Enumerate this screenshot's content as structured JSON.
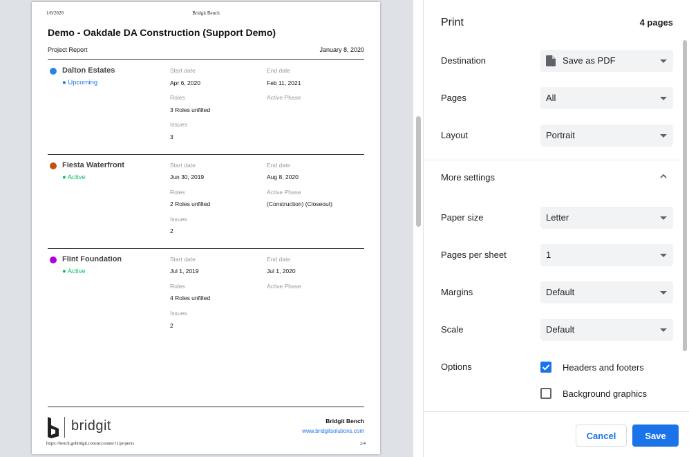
{
  "preview": {
    "header_date": "1/8/2020",
    "header_title": "Bridgit Bench",
    "doc_title": "Demo - Oakdale DA Construction (Support Demo)",
    "doc_subtitle": "Project Report",
    "doc_date": "January 8, 2020",
    "labels": {
      "start_date": "Start date",
      "end_date": "End date",
      "roles": "Roles",
      "active_phase": "Active Phase",
      "issues": "Issues"
    },
    "projects": [
      {
        "name": "Dalton Estates",
        "status": "● Upcoming",
        "status_color": "#1a73e8",
        "dot_color": "#2f80ed",
        "start": "Apr 6, 2020",
        "end": "Feb 11, 2021",
        "roles": "3 Roles unfilled",
        "phase": "",
        "issues": "3"
      },
      {
        "name": "Fiesta Waterfront",
        "status": "● Active",
        "status_color": "#0bbf6a",
        "dot_color": "#c4510f",
        "start": "Jun 30, 2019",
        "end": "Aug 8, 2020",
        "roles": "2 Roles unfilled",
        "phase": "(Construction) (Closeout)",
        "issues": "2"
      },
      {
        "name": "Flint Foundation",
        "status": "● Active",
        "status_color": "#0bbf6a",
        "dot_color": "#b000d8",
        "start": "Jul 1, 2019",
        "end": "Jul 1, 2020",
        "roles": "4 Roles unfilled",
        "phase": "",
        "issues": "2"
      }
    ],
    "logo_text": "bridgit",
    "footer_brand": "Bridgit Bench",
    "footer_site": "www.bridgitsolutions.com",
    "footer_url": "https://bench.gobridgit.com/accounts/11/projects",
    "footer_page": "2/4"
  },
  "settings": {
    "title": "Print",
    "page_count": "4 pages",
    "destination": {
      "label": "Destination",
      "value": "Save as PDF"
    },
    "pages": {
      "label": "Pages",
      "value": "All"
    },
    "layout": {
      "label": "Layout",
      "value": "Portrait"
    },
    "more_settings": "More settings",
    "paper_size": {
      "label": "Paper size",
      "value": "Letter"
    },
    "pages_per_sheet": {
      "label": "Pages per sheet",
      "value": "1"
    },
    "margins": {
      "label": "Margins",
      "value": "Default"
    },
    "scale": {
      "label": "Scale",
      "value": "Default"
    },
    "options": {
      "label": "Options",
      "headers_footers": "Headers and footers",
      "headers_footers_checked": true,
      "background_graphics": "Background graphics",
      "background_graphics_checked": false
    },
    "cancel": "Cancel",
    "save": "Save",
    "accent_color": "#1a73e8"
  }
}
